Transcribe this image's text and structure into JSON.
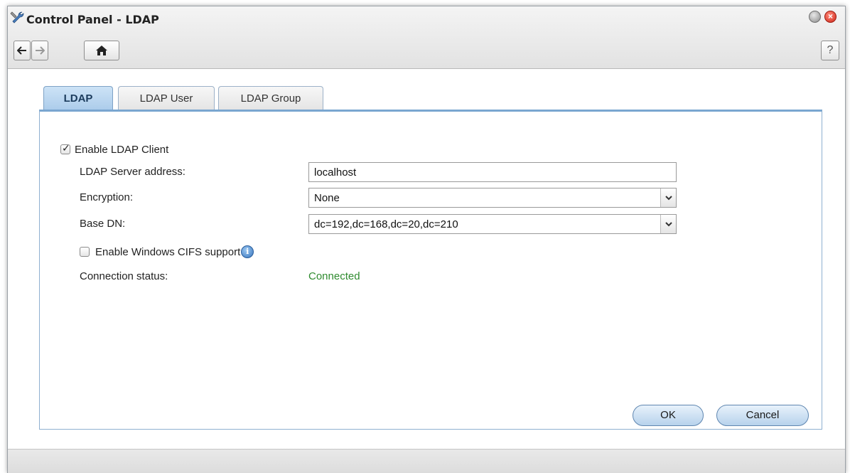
{
  "window": {
    "title": "Control Panel - LDAP",
    "help_label": "?"
  },
  "toolbar": {
    "back_icon": "arrow-left-icon",
    "forward_icon": "arrow-right-icon",
    "home_icon": "home-icon"
  },
  "tabs": [
    {
      "label": "LDAP",
      "active": true
    },
    {
      "label": "LDAP User",
      "active": false
    },
    {
      "label": "LDAP Group",
      "active": false
    }
  ],
  "form": {
    "enable_client_label": "Enable LDAP Client",
    "enable_client_checked": true,
    "server_address_label": "LDAP Server address:",
    "server_address_value": "localhost",
    "encryption_label": "Encryption:",
    "encryption_value": "None",
    "base_dn_label": "Base DN:",
    "base_dn_value": "dc=192,dc=168,dc=20,dc=210",
    "cifs_label": "Enable Windows CIFS support",
    "cifs_checked": false,
    "status_label": "Connection status:",
    "status_value": "Connected"
  },
  "buttons": {
    "ok_label": "OK",
    "cancel_label": "Cancel"
  },
  "colors": {
    "status_connected": "#2f8b2f",
    "active_tab": "#aacbea",
    "close_button": "#d0271a"
  }
}
